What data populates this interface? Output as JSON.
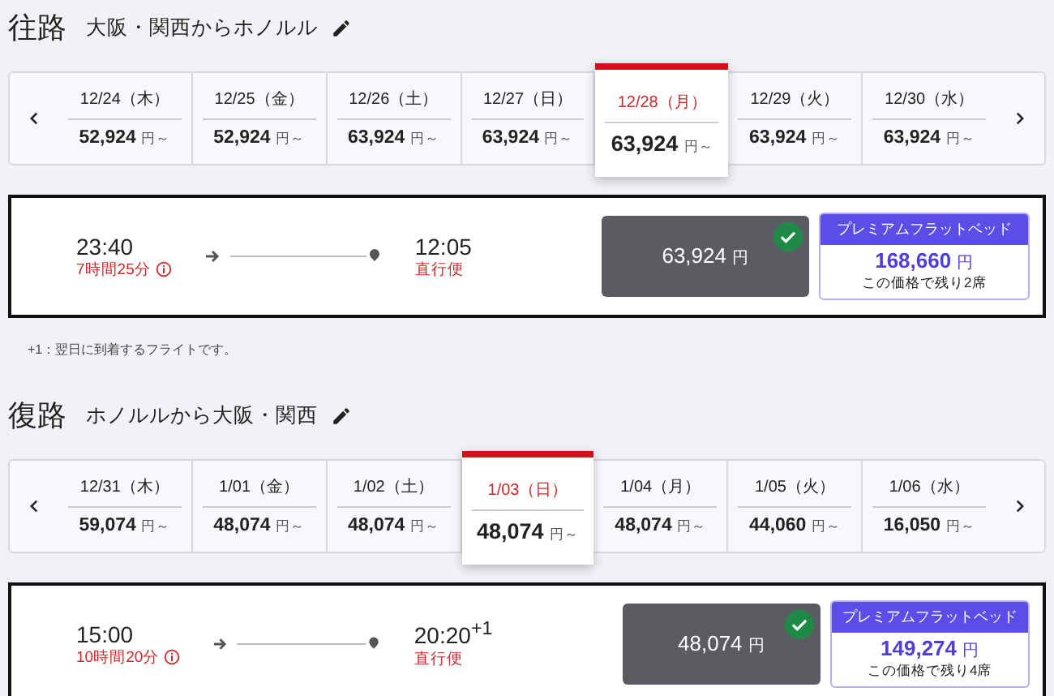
{
  "sections": [
    {
      "label": "往路",
      "route": "大阪・関西からホノルル",
      "dates": [
        {
          "date": "12/24（木）",
          "price": "52,924",
          "unit": "円～",
          "selected": false
        },
        {
          "date": "12/25（金）",
          "price": "52,924",
          "unit": "円～",
          "selected": false
        },
        {
          "date": "12/26（土）",
          "price": "63,924",
          "unit": "円～",
          "selected": false
        },
        {
          "date": "12/27（日）",
          "price": "63,924",
          "unit": "円～",
          "selected": false
        },
        {
          "date": "12/28（月）",
          "price": "63,924",
          "unit": "円～",
          "selected": true
        },
        {
          "date": "12/29（火）",
          "price": "63,924",
          "unit": "円～",
          "selected": false
        },
        {
          "date": "12/30（水）",
          "price": "63,924",
          "unit": "円～",
          "selected": false
        }
      ],
      "flight": {
        "depart": "23:40",
        "duration": "7時間25分",
        "arrive": "12:05",
        "type": "直行便",
        "fare": {
          "price": "63,924",
          "unit": "円",
          "selected": true
        },
        "premium": {
          "label": "プレミアムフラットベッド",
          "price": "168,660",
          "unit": "円",
          "note": "この価格で残り2席",
          "selected": false
        }
      },
      "note": "+1：翌日に到着するフライトです。"
    },
    {
      "label": "復路",
      "route": "ホノルルから大阪・関西",
      "dates": [
        {
          "date": "12/31（木）",
          "price": "59,074",
          "unit": "円～",
          "selected": false
        },
        {
          "date": "1/01（金）",
          "price": "48,074",
          "unit": "円～",
          "selected": false
        },
        {
          "date": "1/02（土）",
          "price": "48,074",
          "unit": "円～",
          "selected": false
        },
        {
          "date": "1/03（日）",
          "price": "48,074",
          "unit": "円～",
          "selected": true
        },
        {
          "date": "1/04（月）",
          "price": "48,074",
          "unit": "円～",
          "selected": false
        },
        {
          "date": "1/05（火）",
          "price": "44,060",
          "unit": "円～",
          "selected": false
        },
        {
          "date": "1/06（水）",
          "price": "16,050",
          "unit": "円～",
          "selected": false
        }
      ],
      "flight": {
        "depart": "15:00",
        "duration": "10時間20分",
        "arrive": "20:20$^{+1}$",
        "type": "直行便",
        "fare": {
          "price": "48,074",
          "unit": "円",
          "selected": true
        },
        "premium": {
          "label": "プレミアムフラットベッド",
          "price": "149,274",
          "unit": "円",
          "note": "この価格で残り4席",
          "selected": false
        }
      }
    }
  ]
}
